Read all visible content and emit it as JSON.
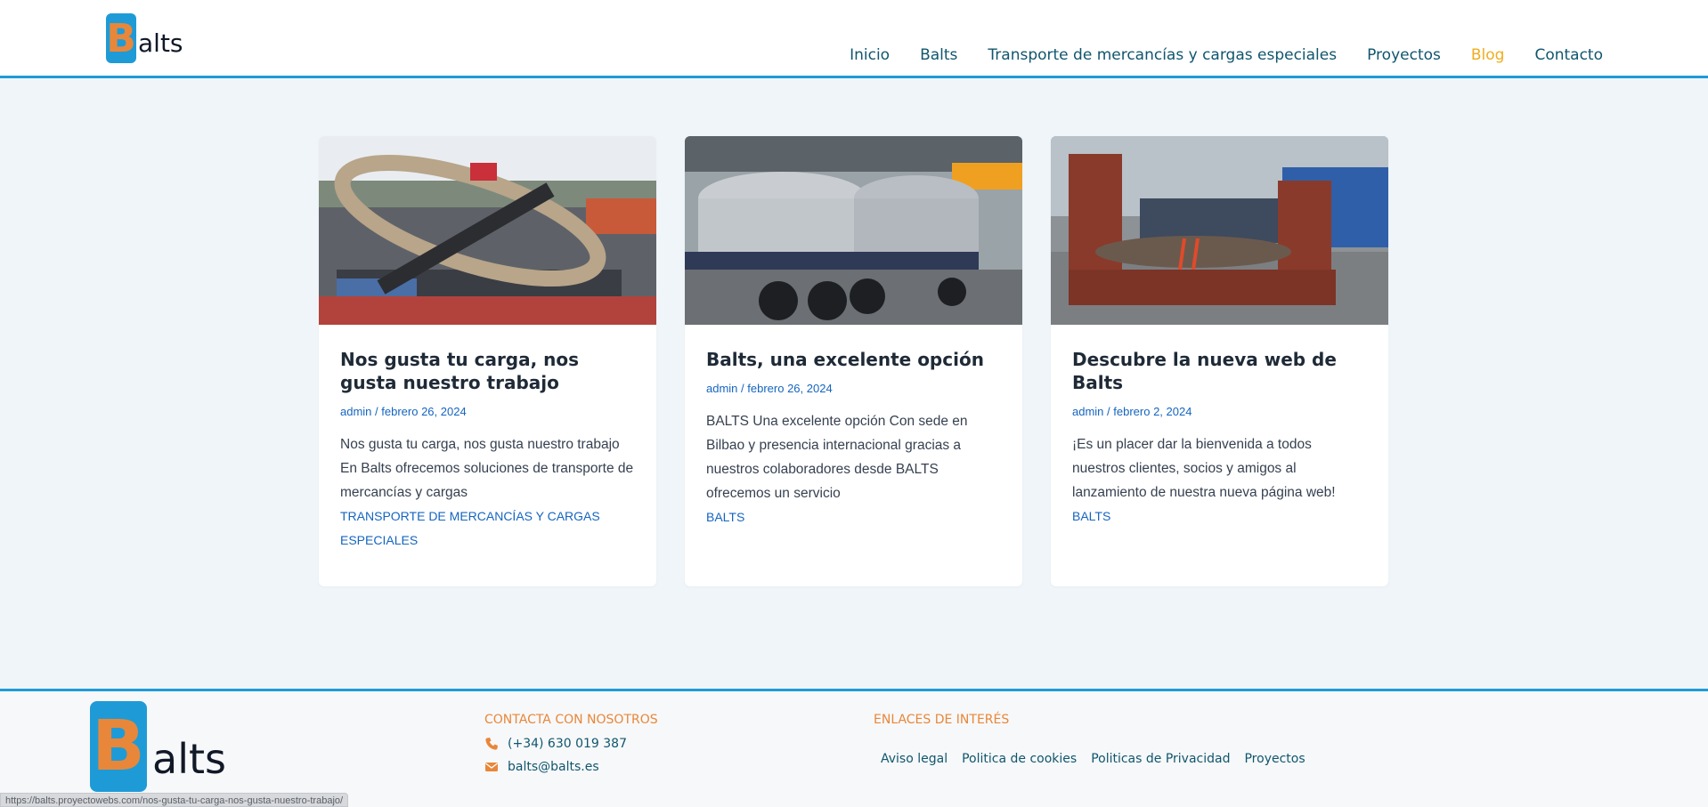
{
  "header": {
    "logo_letter": "B",
    "logo_rest": "alts",
    "nav": [
      "Inicio",
      "Balts",
      "Transporte de mercancías y cargas especiales",
      "Proyectos",
      "Blog",
      "Contacto"
    ],
    "active_nav": "Blog"
  },
  "posts": [
    {
      "title": "Nos gusta tu carga, nos gusta nuestro trabajo",
      "author": "admin",
      "date": "febrero 26, 2024",
      "excerpt": "Nos gusta tu carga, nos gusta nuestro trabajo En Balts ofrecemos soluciones de transporte de mercancías y cargas",
      "category": "Transporte de mercancías y cargas especiales"
    },
    {
      "title": "Balts, una excelente opción",
      "author": "admin",
      "date": "febrero 26, 2024",
      "excerpt": "BALTS Una excelente opción Con sede en Bilbao y presencia internacional gracias a nuestros colaboradores desde BALTS ofrecemos un servicio",
      "category": "Balts"
    },
    {
      "title": "Descubre la nueva web de Balts",
      "author": "admin",
      "date": "febrero 2, 2024",
      "excerpt": "¡Es un placer dar la bienvenida a todos nuestros clientes, socios y amigos al lanzamiento de nuestra nueva página web!",
      "category": "Balts"
    }
  ],
  "footer": {
    "logo_letter": "B",
    "logo_rest": "alts",
    "contact_title": "Contacta con nosotros",
    "phone": "(+34) 630 019 387",
    "email": "balts@balts.es",
    "links_title": "Enlaces de interés",
    "links": [
      "Aviso legal",
      "Politica de cookies",
      "Politicas de Privacidad",
      "Proyectos"
    ]
  },
  "status_url": "https://balts.proyectowebs.com/nos-gusta-tu-carga-nos-gusta-nuestro-trabajo/",
  "colors": {
    "accent": "#1e9bd7",
    "orange": "#e8873a",
    "nav": "#10566e",
    "active": "#f0ad1e",
    "link": "#1565c0"
  }
}
